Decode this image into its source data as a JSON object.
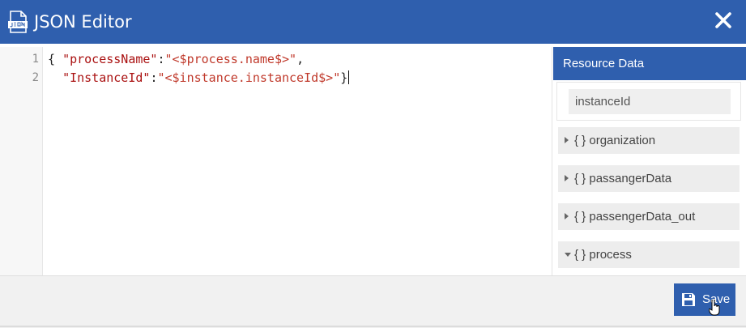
{
  "window": {
    "title": "JSON Editor",
    "icon": "json-file-icon",
    "close_icon": "close-icon"
  },
  "editor": {
    "line_numbers": [
      "1",
      "2"
    ],
    "lines": [
      [
        {
          "t": "{ ",
          "c": "p"
        },
        {
          "t": "\"processName\"",
          "c": "k"
        },
        {
          "t": ":",
          "c": "p"
        },
        {
          "t": "\"<$process.name$>\"",
          "c": "s"
        },
        {
          "t": ",",
          "c": "p"
        }
      ],
      [
        {
          "t": "  ",
          "c": "p"
        },
        {
          "t": "\"InstanceId\"",
          "c": "k"
        },
        {
          "t": ":",
          "c": "p"
        },
        {
          "t": "\"<$instance.instanceId$>\"",
          "c": "s"
        },
        {
          "t": "}",
          "c": "p"
        }
      ]
    ]
  },
  "resource_panel": {
    "header": "Resource Data",
    "instance_field": "instanceId",
    "items": [
      {
        "label": "{ } organization",
        "expanded": false
      },
      {
        "label": "{ } passangerData",
        "expanded": false
      },
      {
        "label": "{ } passengerData_out",
        "expanded": false
      },
      {
        "label": "{ } process",
        "expanded": true
      }
    ]
  },
  "footer": {
    "save_label": "Save",
    "save_icon": "floppy-disk-icon"
  },
  "colors": {
    "primary": "#2f5fae",
    "key": "#aa1111",
    "string": "#c0392b"
  }
}
